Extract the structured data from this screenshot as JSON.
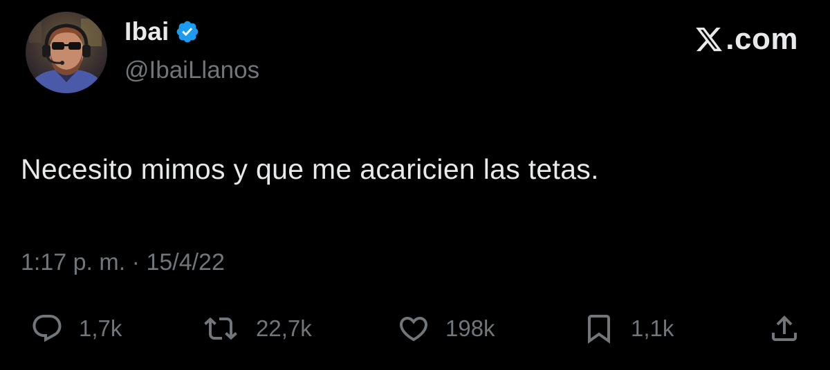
{
  "author": {
    "display_name": "Ibai",
    "handle": "@IbaiLlanos",
    "verified": true,
    "avatar": "profile-photo-man-with-headset-and-sunglasses"
  },
  "brand": {
    "logo": "x-logo",
    "text": ".com"
  },
  "tweet": {
    "text": "Necesito mimos y que me acaricien las tetas.",
    "time": "1:17 p. m.",
    "separator": "·",
    "date": "15/4/22"
  },
  "actions": {
    "reply": {
      "icon": "reply-icon",
      "count": "1,7k"
    },
    "repost": {
      "icon": "repost-icon",
      "count": "22,7k"
    },
    "like": {
      "icon": "heart-icon",
      "count": "198k"
    },
    "bookmark": {
      "icon": "bookmark-icon",
      "count": "1,1k"
    },
    "share": {
      "icon": "share-icon"
    }
  },
  "colors": {
    "background": "#000000",
    "primary_text": "#e7e9ea",
    "secondary_text": "#71767b",
    "verified_badge": "#1d9bf0"
  }
}
